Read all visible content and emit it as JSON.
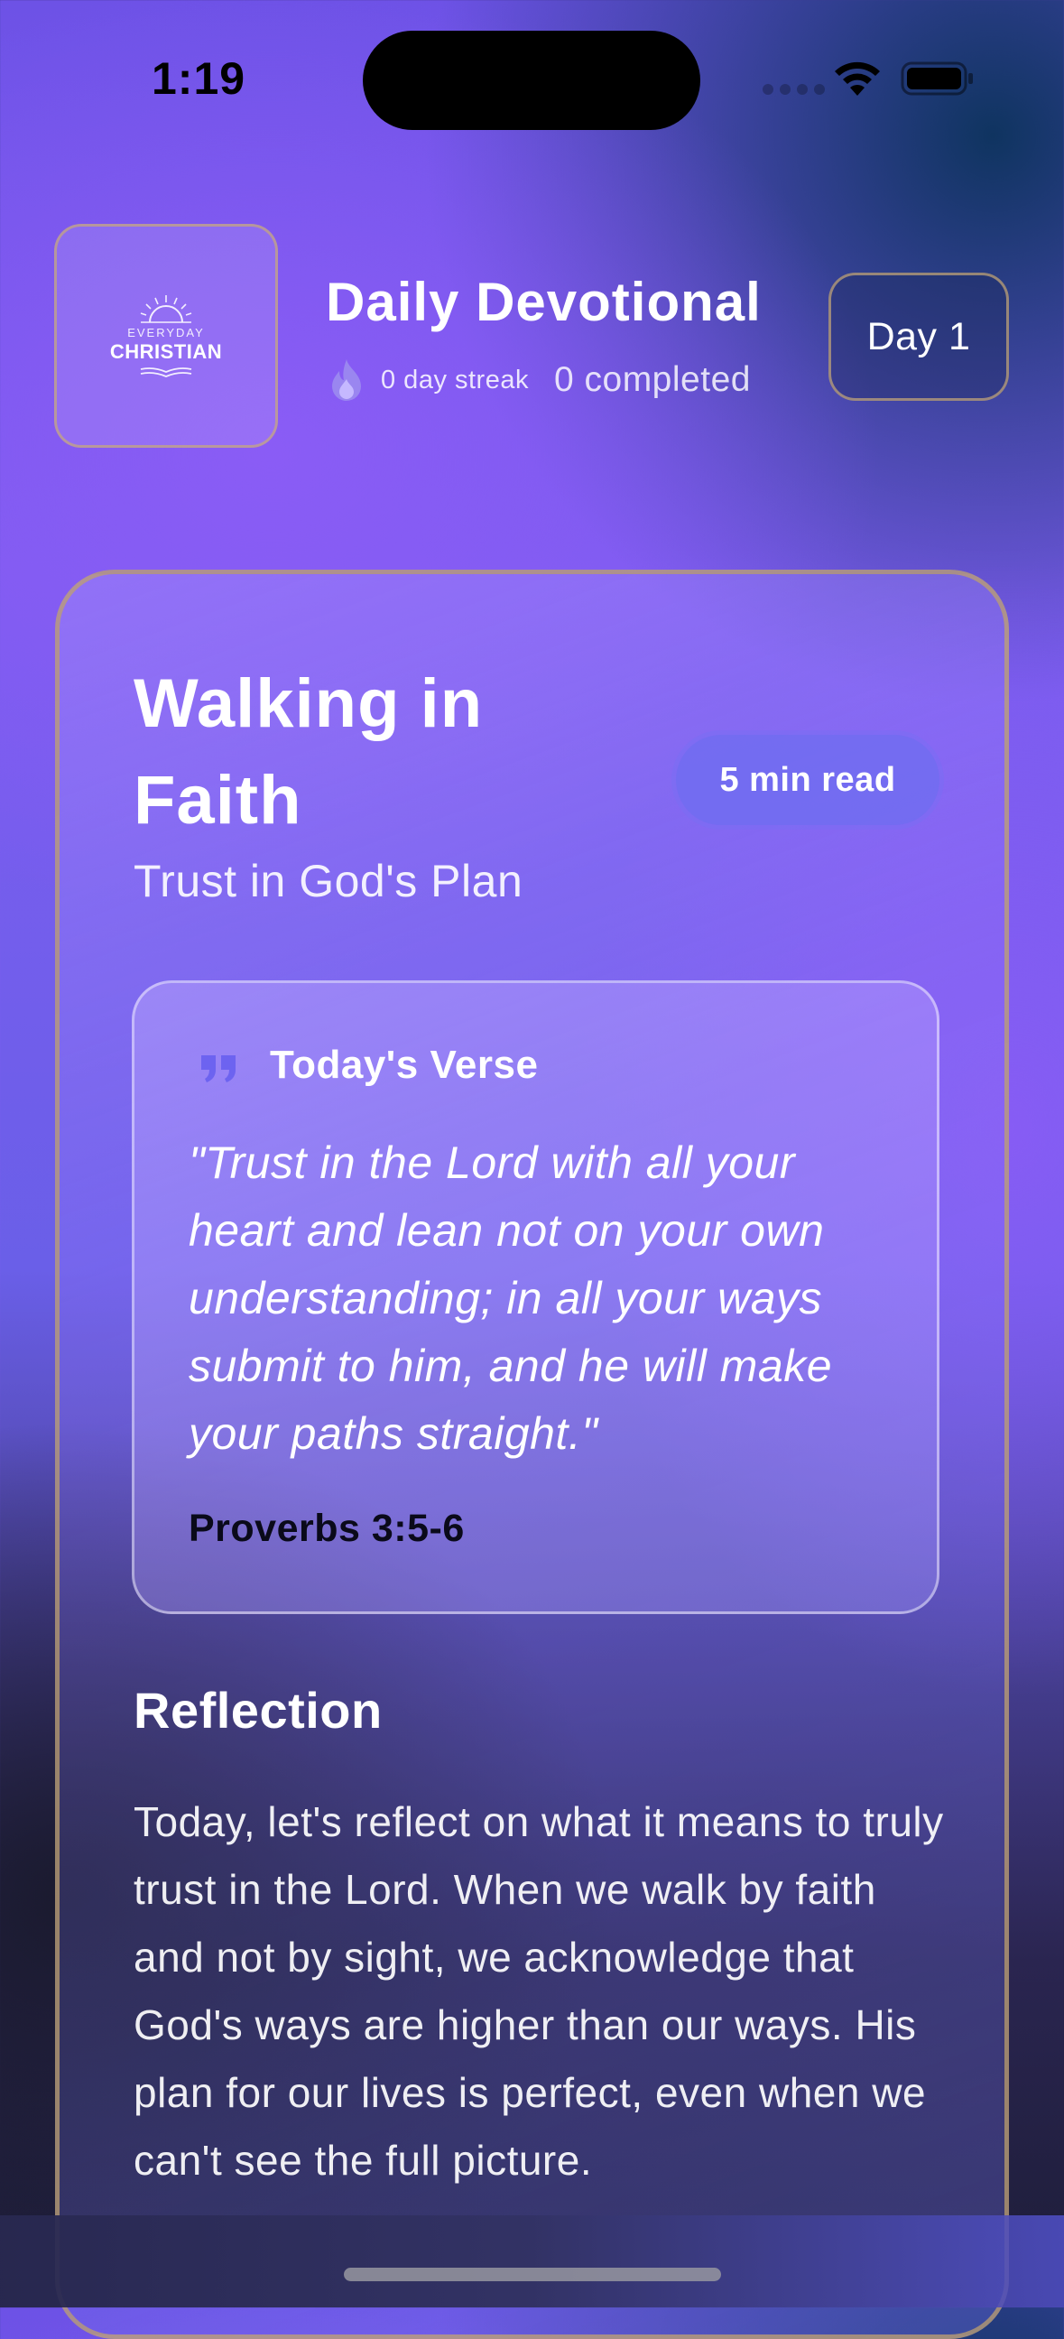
{
  "status_bar": {
    "time": "1:19"
  },
  "header": {
    "logo": {
      "top_text": "EVERYDAY",
      "main_text": "CHRISTIAN"
    },
    "title": "Daily Devotional",
    "streak": "0 day streak",
    "completed": "0 completed",
    "day_badge": "Day 1"
  },
  "devotional": {
    "title": "Walking in Faith",
    "read_time": "5 min read",
    "subtitle": "Trust in God's Plan",
    "verse": {
      "label": "Today's Verse",
      "text": "\"Trust in the Lord with all your heart and lean not on your own understanding; in all your ways submit to him, and he will make your paths straight.\"",
      "reference": "Proverbs 3:5-6"
    },
    "reflection": {
      "heading": "Reflection",
      "text": "Today, let's reflect on what it means to truly trust in the Lord. When we walk by faith and not by sight, we acknowledge that God's ways are higher than our ways. His plan for our lives is perfect, even when we can't see the full picture."
    }
  },
  "icons": {
    "streak": "flame-icon",
    "verse": "quote-icon",
    "wifi": "wifi-icon",
    "battery": "battery-icon"
  },
  "colors": {
    "accent_purple": "#8b5cf6",
    "accent_indigo": "#6366f1",
    "deep_navy": "#0f3460",
    "gold_border": "#bea06e"
  }
}
